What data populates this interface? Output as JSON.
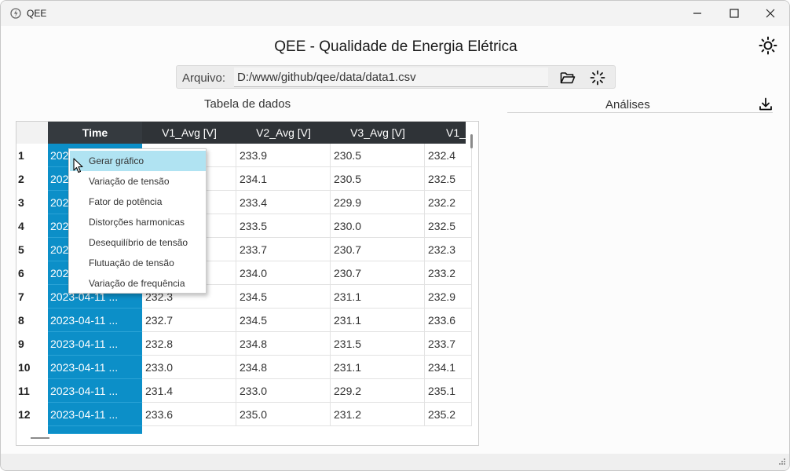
{
  "window": {
    "title": "QEE"
  },
  "header": {
    "title": "QEE - Qualidade de Energia Elétrica"
  },
  "file": {
    "label": "Arquivo:",
    "path": "D:/www/github/qee/data/data1.csv"
  },
  "sections": {
    "table_title": "Tabela de dados",
    "analysis_title": "Análises"
  },
  "table": {
    "columns": [
      "Time",
      "V1_Avg [V]",
      "V2_Avg [V]",
      "V3_Avg [V]",
      "V1_"
    ],
    "rows": [
      {
        "n": "1",
        "time": "202",
        "v1": "",
        "v2": "233.9",
        "v3": "230.5",
        "v4": "232.4"
      },
      {
        "n": "2",
        "time": "202",
        "v1": "",
        "v2": "234.1",
        "v3": "230.5",
        "v4": "232.5"
      },
      {
        "n": "3",
        "time": "202",
        "v1": "",
        "v2": "233.4",
        "v3": "229.9",
        "v4": "232.2"
      },
      {
        "n": "4",
        "time": "202",
        "v1": "",
        "v2": "233.5",
        "v3": "230.0",
        "v4": "232.5"
      },
      {
        "n": "5",
        "time": "202",
        "v1": "",
        "v2": "233.7",
        "v3": "230.7",
        "v4": "232.3"
      },
      {
        "n": "6",
        "time": "202",
        "v1": "",
        "v2": "234.0",
        "v3": "230.7",
        "v4": "233.2"
      },
      {
        "n": "7",
        "time": "2023-04-11 ...",
        "v1": "232.3",
        "v2": "234.5",
        "v3": "231.1",
        "v4": "232.9"
      },
      {
        "n": "8",
        "time": "2023-04-11 ...",
        "v1": "232.7",
        "v2": "234.5",
        "v3": "231.1",
        "v4": "233.6"
      },
      {
        "n": "9",
        "time": "2023-04-11 ...",
        "v1": "232.8",
        "v2": "234.8",
        "v3": "231.5",
        "v4": "233.7"
      },
      {
        "n": "10",
        "time": "2023-04-11 ...",
        "v1": "233.0",
        "v2": "234.8",
        "v3": "231.1",
        "v4": "234.1"
      },
      {
        "n": "11",
        "time": "2023-04-11 ...",
        "v1": "231.4",
        "v2": "233.0",
        "v3": "229.2",
        "v4": "235.1"
      },
      {
        "n": "12",
        "time": "2023-04-11 ...",
        "v1": "233.6",
        "v2": "235.0",
        "v3": "231.2",
        "v4": "235.2"
      }
    ]
  },
  "context_menu": {
    "items": [
      "Gerar gráfico",
      "Variação de tensão",
      "Fator de potência",
      "Distorções harmonicas",
      "Desequilíbrio de tensão",
      "Flutuação de tensão",
      "Variação de frequência"
    ],
    "active_index": 0
  },
  "colors": {
    "accent": "#0c8fc8",
    "header": "#2f3337",
    "menu_highlight": "#b0e3f2"
  },
  "icons": [
    "app-icon",
    "minimize-icon",
    "maximize-icon",
    "close-icon",
    "sun-icon",
    "folder-open-icon",
    "loading-spinner-icon",
    "download-icon",
    "cursor-icon",
    "resize-grip-icon"
  ]
}
